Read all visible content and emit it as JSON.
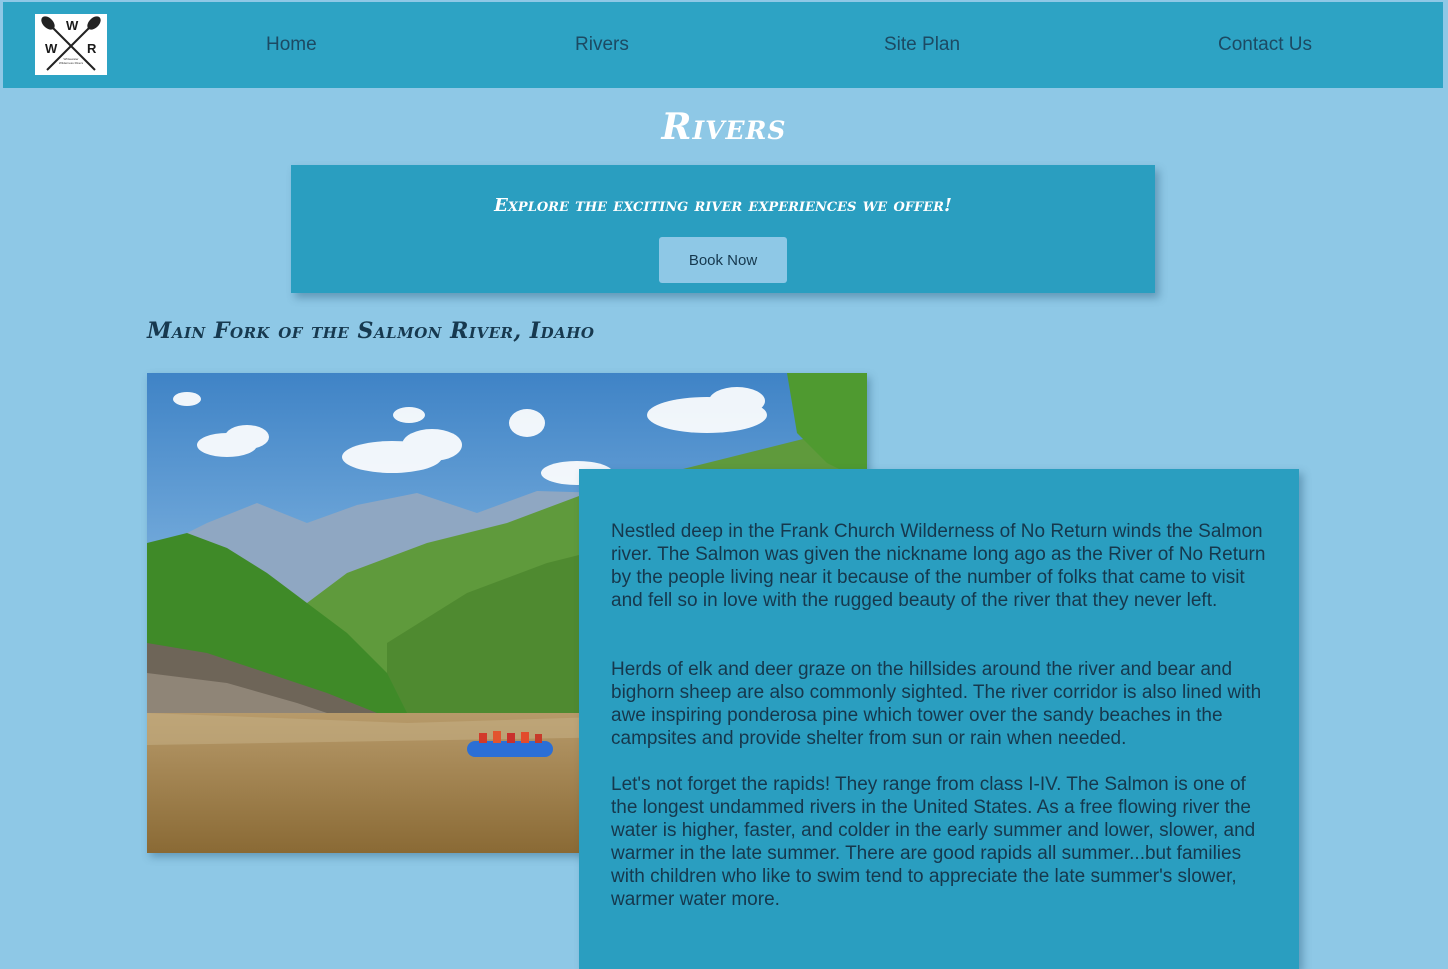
{
  "nav": {
    "logo": {
      "letters": [
        "W",
        "W",
        "R"
      ],
      "tagline": "Whitewater Wilderness Rivers",
      "icon": "crossed-paddles-icon"
    },
    "links": [
      {
        "label": "Home"
      },
      {
        "label": "Rivers"
      },
      {
        "label": "Site Plan"
      },
      {
        "label": "Contact Us"
      }
    ]
  },
  "page": {
    "title": "Rivers"
  },
  "banner": {
    "text": "Explore the exciting river experiences we offer!",
    "button_label": "Book Now"
  },
  "section": {
    "title": "Main Fork of the Salmon River, Idaho",
    "image": "river-rafting-photo",
    "paragraphs": [
      "Nestled deep in the Frank Church Wilderness of No Return winds the Salmon river. The Salmon was given the nickname long ago as the River of No Return by the people living near it because of the number of folks that came to visit and fell so in love with the rugged beauty of the river that they never left.",
      "Herds of elk and deer graze on the hillsides around the river and bear and bighorn sheep are also commonly sighted. The river corridor is also lined with awe inspiring ponderosa pine which tower over the sandy beaches in the campsites and provide shelter from sun or rain when needed.",
      "Let's not forget the rapids! They range from class I-IV. The Salmon is one of the longest undammed rivers in the United States. As a free flowing river the water is higher, faster, and colder in the early summer and lower, slower, and warmer in the late summer. There are good rapids all summer...but families with children who like to swim tend to appreciate the late summer's slower, warmer water more."
    ]
  },
  "colors": {
    "page_bg": "#8ec8e6",
    "nav_bg": "#2da3c4",
    "card_bg": "#2a9ec0",
    "nav_text": "#1c4a63",
    "body_text": "#16384d",
    "heading_white": "#ffffff"
  }
}
